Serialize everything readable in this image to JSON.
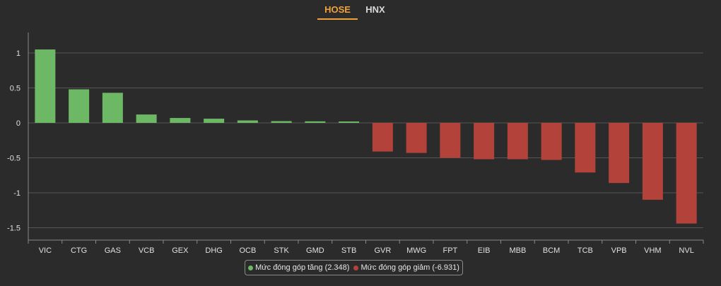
{
  "tabs": [
    {
      "label": "HOSE",
      "active": true
    },
    {
      "label": "HNX",
      "active": false
    }
  ],
  "colors": {
    "positive": "#6db865",
    "negative": "#b2423a",
    "tab_active": "#f0a23a",
    "grid": "#555555",
    "axis_text": "#e0e0e0"
  },
  "legend": {
    "increase_label": "Mức đóng góp tăng (2.348)",
    "decrease_label": "Mức đóng góp giảm (-6.931)"
  },
  "chart_data": {
    "type": "bar",
    "categories": [
      "VIC",
      "CTG",
      "GAS",
      "VCB",
      "GEX",
      "DHG",
      "OCB",
      "STK",
      "GMD",
      "STB",
      "GVR",
      "MWG",
      "FPT",
      "EIB",
      "MBB",
      "BCM",
      "TCB",
      "VPB",
      "VHM",
      "NVL"
    ],
    "values": [
      1.05,
      0.48,
      0.43,
      0.12,
      0.07,
      0.06,
      0.035,
      0.025,
      0.022,
      0.02,
      -0.41,
      -0.43,
      -0.5,
      -0.52,
      -0.52,
      -0.53,
      -0.71,
      -0.86,
      -1.1,
      -1.44
    ],
    "yticks": [
      1,
      0.5,
      0,
      -0.5,
      -1,
      -1.5
    ],
    "ytick_labels": [
      "1",
      "0.5",
      "0",
      "-0.5",
      "-1",
      "-1.5"
    ],
    "ylim": [
      -1.55,
      1.28
    ],
    "grid": true,
    "legend_position": "bottom-center"
  }
}
